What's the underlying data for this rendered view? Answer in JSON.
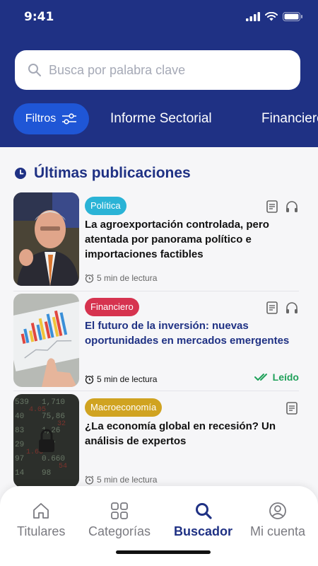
{
  "status": {
    "time": "9:41"
  },
  "search": {
    "placeholder": "Busca por palabra clave"
  },
  "chips": [
    {
      "label": "Filtros"
    },
    {
      "label": "Informe Sectorial"
    },
    {
      "label": "Financiero"
    }
  ],
  "section": {
    "title": "Últimas publicaciones"
  },
  "articles": [
    {
      "tag": "Política",
      "tag_color": "#2ab3d6",
      "headline": "La agroexportación controlada, pero atentada por panorama político e importaciones factibles",
      "read_time": "5 min de lectura",
      "headline_color": "#111111"
    },
    {
      "tag": "Financiero",
      "tag_color": "#d6334f",
      "headline": "El futuro de la inversión: nuevas oportunidades en mercados emergentes",
      "read_time": "5 min de lectura",
      "read_label": "Leído",
      "headline_color": "#1f3184"
    },
    {
      "tag": "Macroeconomía",
      "tag_color": "#d0a321",
      "headline": "¿La economía global en recesión?  Un análisis de expertos",
      "read_time": "5 min de lectura",
      "headline_color": "#111111"
    }
  ],
  "tabbar": {
    "items": [
      {
        "label": "Titulares",
        "icon": "home-icon"
      },
      {
        "label": "Categorías",
        "icon": "grid-icon"
      },
      {
        "label": "Buscador",
        "icon": "search-icon",
        "active": true
      },
      {
        "label": "Mi cuenta",
        "icon": "user-icon"
      }
    ]
  },
  "colors": {
    "header": "#1f3184",
    "primary": "#1f56d6",
    "read": "#21a15b"
  }
}
